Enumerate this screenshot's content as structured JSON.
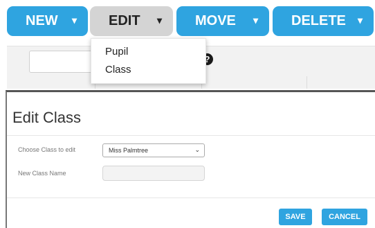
{
  "toolbar": {
    "new_label": "NEW",
    "edit_label": "EDIT",
    "move_label": "MOVE",
    "delete_label": "DELETE",
    "caret": "▾"
  },
  "edit_menu": {
    "items": [
      {
        "label": "Pupil"
      },
      {
        "label": "Class"
      }
    ]
  },
  "background": {
    "help_glyph": "?"
  },
  "dialog": {
    "title": "Edit Class",
    "choose_label": "Choose Class to edit",
    "choose_value": "Miss Palmtree",
    "new_name_label": "New Class Name",
    "new_name_value": "",
    "save_label": "SAVE",
    "cancel_label": "CANCEL"
  },
  "colors": {
    "accent": "#2fa4e0",
    "active_button": "#d4d4d4"
  },
  "icons": [
    "chevron-down-icon",
    "help-icon"
  ]
}
